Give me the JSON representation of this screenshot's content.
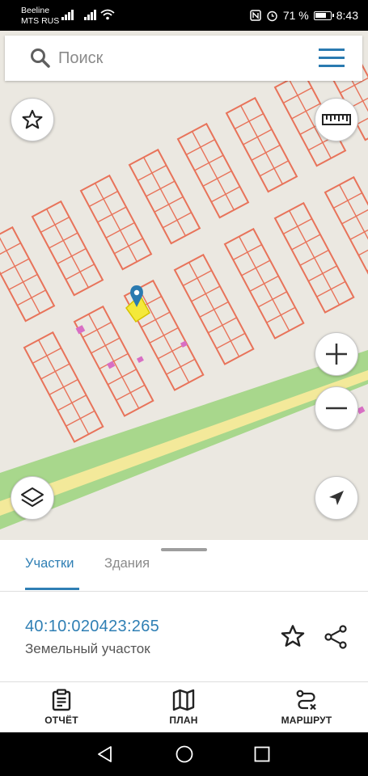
{
  "status_bar": {
    "carrier_line1": "Beeline",
    "carrier_line2": "MTS RUS",
    "battery": "71 %",
    "time": "8:43"
  },
  "search": {
    "placeholder": "Поиск"
  },
  "map": {
    "buttons": [
      "favorites-star-icon",
      "ruler-icon",
      "zoom-in-icon",
      "zoom-out-icon",
      "layers-icon",
      "my-location-arrow-icon"
    ]
  },
  "sheet": {
    "tabs": [
      {
        "label": "Участки",
        "active": true
      },
      {
        "label": "Здания",
        "active": false
      }
    ],
    "parcel": {
      "cadastral_number": "40:10:020423:265",
      "type": "Земельный участок"
    }
  },
  "bottom_nav": {
    "items": [
      {
        "label": "ОТЧЁТ",
        "icon": "report-clipboard-icon"
      },
      {
        "label": "ПЛАН",
        "icon": "map-plan-icon"
      },
      {
        "label": "МАРШРУТ",
        "icon": "route-icon"
      }
    ]
  },
  "colors": {
    "accent": "#2f7fb4",
    "parcel_lines": "#e8735a",
    "selected_parcel": "#f4e93a",
    "road": "#a6d58a"
  }
}
